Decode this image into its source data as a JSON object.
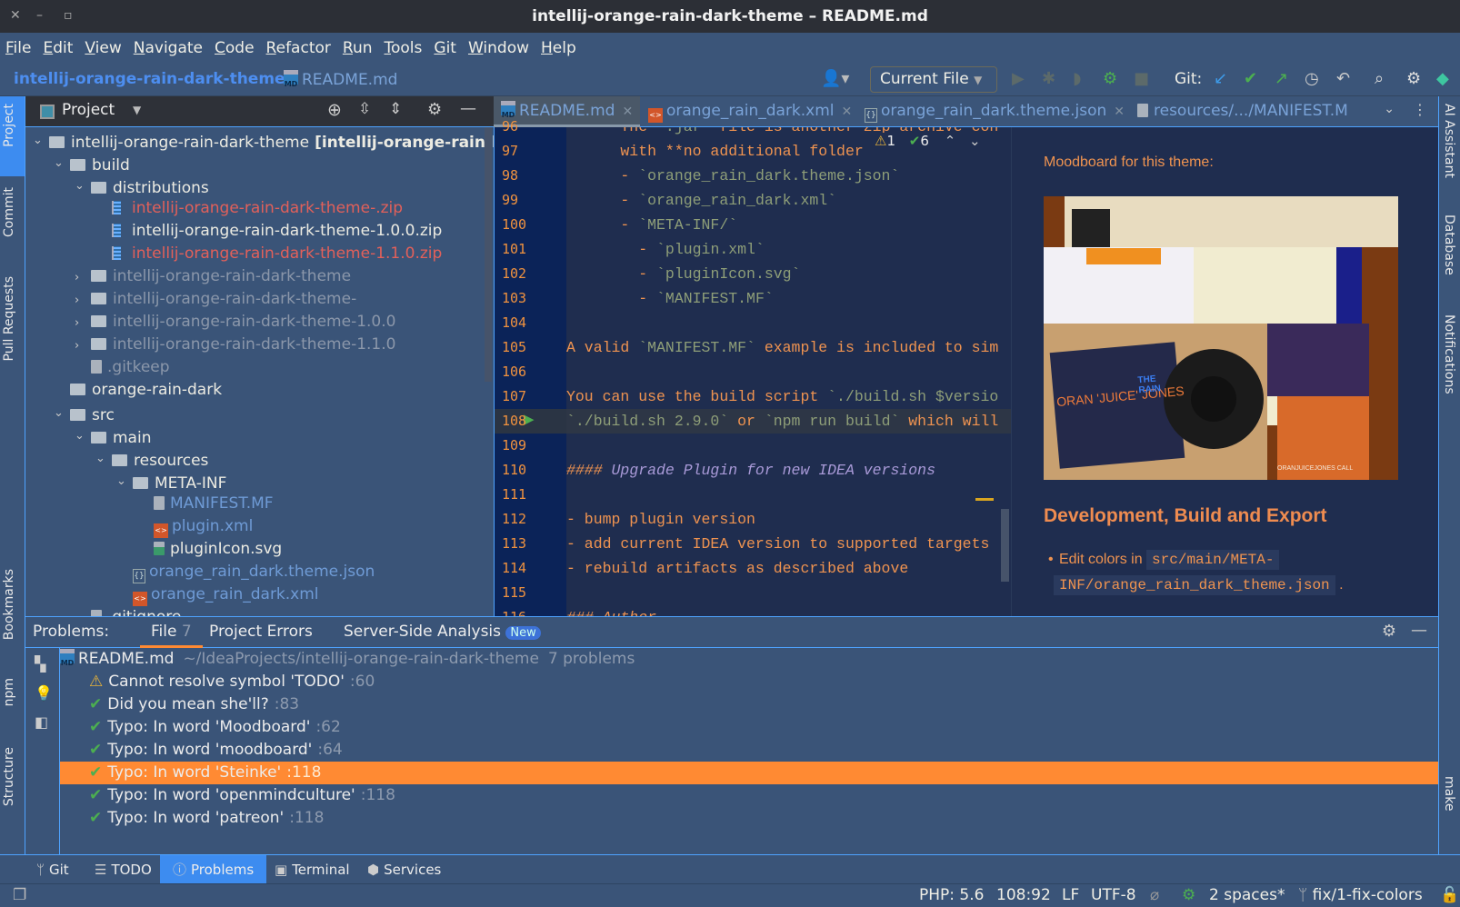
{
  "window": {
    "title": "intellij-orange-rain-dark-theme – README.md"
  },
  "menu": [
    "File",
    "Edit",
    "View",
    "Navigate",
    "Code",
    "Refactor",
    "Run",
    "Tools",
    "Git",
    "Window",
    "Help"
  ],
  "breadcrumb": {
    "project": "intellij-orange-rain-dark-theme",
    "file": "README.md"
  },
  "toolbar": {
    "run_config": "Current File",
    "git_label": "Git:"
  },
  "left_strip": [
    "Project",
    "Commit",
    "Pull Requests",
    "Bookmarks",
    "npm",
    "Structure"
  ],
  "right_strip": [
    "AI Assistant",
    "Database",
    "Notifications",
    "make"
  ],
  "project_panel": {
    "title": "Project",
    "tree": [
      {
        "label": "intellij-orange-rain-dark-theme",
        "extra": "[intellij-orange-rain-lig",
        "depth": 0,
        "kind": "folder",
        "arrow": "open",
        "color": "#ecebe2"
      },
      {
        "label": "build",
        "depth": 1,
        "kind": "folder",
        "arrow": "open",
        "color": "#ecebe2"
      },
      {
        "label": "distributions",
        "depth": 2,
        "kind": "folder",
        "arrow": "open",
        "color": "#ecebe2"
      },
      {
        "label": "intellij-orange-rain-dark-theme-.zip",
        "depth": 3,
        "kind": "zip",
        "arrow": "",
        "color": "#e2605a"
      },
      {
        "label": "intellij-orange-rain-dark-theme-1.0.0.zip",
        "depth": 3,
        "kind": "zip",
        "arrow": "",
        "color": "#ecebe2"
      },
      {
        "label": "intellij-orange-rain-dark-theme-1.1.0.zip",
        "depth": 3,
        "kind": "zip",
        "arrow": "",
        "color": "#e2605a"
      },
      {
        "label": "intellij-orange-rain-dark-theme",
        "depth": 2,
        "kind": "folder",
        "arrow": "closed",
        "color": "#8b97aa"
      },
      {
        "label": "intellij-orange-rain-dark-theme-",
        "depth": 2,
        "kind": "folder",
        "arrow": "closed",
        "color": "#8b97aa"
      },
      {
        "label": "intellij-orange-rain-dark-theme-1.0.0",
        "depth": 2,
        "kind": "folder",
        "arrow": "closed",
        "color": "#8b97aa"
      },
      {
        "label": "intellij-orange-rain-dark-theme-1.1.0",
        "depth": 2,
        "kind": "folder",
        "arrow": "closed",
        "color": "#8b97aa"
      },
      {
        "label": ".gitkeep",
        "depth": 2,
        "kind": "file",
        "arrow": "",
        "color": "#8b97aa"
      },
      {
        "label": "orange-rain-dark",
        "depth": 1,
        "kind": "folder",
        "arrow": "",
        "color": "#ecebe2"
      },
      {
        "label": "src",
        "depth": 1,
        "kind": "folder",
        "arrow": "open",
        "color": "#ecebe2"
      },
      {
        "label": "main",
        "depth": 2,
        "kind": "folder",
        "arrow": "open",
        "color": "#ecebe2"
      },
      {
        "label": "resources",
        "depth": 3,
        "kind": "folder",
        "arrow": "open",
        "color": "#ecebe2"
      },
      {
        "label": "META-INF",
        "depth": 4,
        "kind": "folder",
        "arrow": "open",
        "color": "#ecebe2"
      },
      {
        "label": "MANIFEST.MF",
        "depth": 5,
        "kind": "file",
        "arrow": "",
        "color": "#6f9bd6"
      },
      {
        "label": "plugin.xml",
        "depth": 5,
        "kind": "xml",
        "arrow": "",
        "color": "#6f9bd6"
      },
      {
        "label": "pluginIcon.svg",
        "depth": 5,
        "kind": "svg",
        "arrow": "",
        "color": "#ecebe2"
      },
      {
        "label": "orange_rain_dark.theme.json",
        "depth": 4,
        "kind": "json",
        "arrow": "",
        "color": "#6f9bd6"
      },
      {
        "label": "orange_rain_dark.xml",
        "depth": 4,
        "kind": "xml",
        "arrow": "",
        "color": "#6f9bd6"
      },
      {
        "label": ".gitignore",
        "depth": 2,
        "kind": "file",
        "arrow": "",
        "color": "#ecebe2"
      }
    ]
  },
  "editor": {
    "tabs": [
      {
        "label": "README.md",
        "icon": "md",
        "active": true
      },
      {
        "label": "orange_rain_dark.xml",
        "icon": "xml"
      },
      {
        "label": "orange_rain_dark.theme.json",
        "icon": "json"
      },
      {
        "label": "resources/.../MANIFEST.M",
        "icon": "file"
      }
    ],
    "inspection": {
      "warnings": "1",
      "typos": "6"
    },
    "current_line": 108,
    "lines": [
      {
        "n": "96",
        "segs": [
          [
            "text",
            "      The `"
          ],
          [
            "code",
            ".jar"
          ],
          [
            "text",
            "` file is another zip archive con"
          ]
        ]
      },
      {
        "n": "97",
        "segs": [
          [
            "text",
            "      with **no additional folder"
          ]
        ]
      },
      {
        "n": "98",
        "segs": [
          [
            "text",
            "      - "
          ],
          [
            "code",
            "`orange_rain_dark.theme.json`"
          ]
        ]
      },
      {
        "n": "99",
        "segs": [
          [
            "text",
            "      - "
          ],
          [
            "code",
            "`orange_rain_dark.xml`"
          ]
        ]
      },
      {
        "n": "100",
        "segs": [
          [
            "text",
            "      - "
          ],
          [
            "code",
            "`META-INF/`"
          ]
        ]
      },
      {
        "n": "101",
        "segs": [
          [
            "text",
            "        - "
          ],
          [
            "code",
            "`plugin.xml`"
          ]
        ]
      },
      {
        "n": "102",
        "segs": [
          [
            "text",
            "        - "
          ],
          [
            "code",
            "`pluginIcon.svg`"
          ]
        ]
      },
      {
        "n": "103",
        "segs": [
          [
            "text",
            "        - "
          ],
          [
            "code",
            "`MANIFEST.MF`"
          ]
        ]
      },
      {
        "n": "104",
        "segs": []
      },
      {
        "n": "105",
        "segs": [
          [
            "text",
            "A valid "
          ],
          [
            "code",
            "`MANIFEST.MF`"
          ],
          [
            "text",
            " example is included to sim"
          ]
        ]
      },
      {
        "n": "106",
        "segs": []
      },
      {
        "n": "107",
        "segs": [
          [
            "text",
            "You can use the build script "
          ],
          [
            "code",
            "`./build.sh $versio"
          ]
        ]
      },
      {
        "n": "108",
        "segs": [
          [
            "code",
            "`./build.sh 2.9.0`"
          ],
          [
            "text",
            " or "
          ],
          [
            "code",
            "`npm run build`"
          ],
          [
            "text",
            " which will"
          ]
        ]
      },
      {
        "n": "109",
        "segs": []
      },
      {
        "n": "110",
        "segs": [
          [
            "hmark",
            "####"
          ],
          [
            "head",
            " Upgrade Plugin for new IDEA versions"
          ]
        ]
      },
      {
        "n": "111",
        "segs": []
      },
      {
        "n": "112",
        "segs": [
          [
            "text",
            "- bump plugin version"
          ]
        ]
      },
      {
        "n": "113",
        "segs": [
          [
            "text",
            "- add current IDEA version to supported targets"
          ]
        ]
      },
      {
        "n": "114",
        "segs": [
          [
            "text",
            "- rebuild artifacts as described above"
          ]
        ]
      },
      {
        "n": "115",
        "segs": []
      },
      {
        "n": "116",
        "segs": [
          [
            "hmark",
            "### Author"
          ]
        ]
      }
    ]
  },
  "preview": {
    "intro": "Moodboard for this theme:",
    "heading": "Development, Build and Export",
    "bullet_text": "Edit colors in",
    "bullet_code1": "src/main/META-",
    "bullet_code2": "INF/orange_rain_dark_theme.json",
    "bullet_end": ".",
    "image_text": {
      "album": "ORAN 'JUICE' JONES",
      "album2": "THE RAIN",
      "album3": "ORANJUICEJONES CALL"
    }
  },
  "problems": {
    "label": "Problems:",
    "tabs": [
      {
        "label": "File",
        "count": "7"
      },
      {
        "label": "Project Errors"
      },
      {
        "label": "Server-Side Analysis",
        "badge": "New"
      }
    ],
    "file": {
      "name": "README.md",
      "path": "~/IdeaProjects/intellij-orange-rain-dark-theme",
      "count": "7 problems"
    },
    "items": [
      {
        "icon": "warning",
        "text": "Cannot resolve symbol 'TODO'",
        "line": ":60"
      },
      {
        "icon": "grammar",
        "text": "Did you mean she'll?",
        "line": ":83"
      },
      {
        "icon": "typo",
        "text": "Typo: In word 'Moodboard'",
        "line": ":62"
      },
      {
        "icon": "typo",
        "text": "Typo: In word 'moodboard'",
        "line": ":64"
      },
      {
        "icon": "typo",
        "text": "Typo: In word 'Steinke'",
        "line": ":118",
        "selected": true
      },
      {
        "icon": "typo",
        "text": "Typo: In word 'openmindculture'",
        "line": ":118"
      },
      {
        "icon": "typo",
        "text": "Typo: In word 'patreon'",
        "line": ":118"
      }
    ]
  },
  "bottom_tabs": [
    {
      "label": "Git",
      "icon": "branch"
    },
    {
      "label": "TODO",
      "icon": "list"
    },
    {
      "label": "Problems",
      "icon": "info",
      "active": true
    },
    {
      "label": "Terminal",
      "icon": "terminal"
    },
    {
      "label": "Services",
      "icon": "services"
    }
  ],
  "status": {
    "php": "PHP: 5.6",
    "position": "108:92",
    "line_sep": "LF",
    "encoding": "UTF-8",
    "indent": "2 spaces*",
    "branch": "fix/1-fix-colors"
  },
  "colors": {
    "accent": "#ff8a33",
    "link": "#4d8ef0",
    "panel": "#3a5478",
    "editor_bg": "#1f2d4f",
    "gutter": "#0b2358"
  }
}
